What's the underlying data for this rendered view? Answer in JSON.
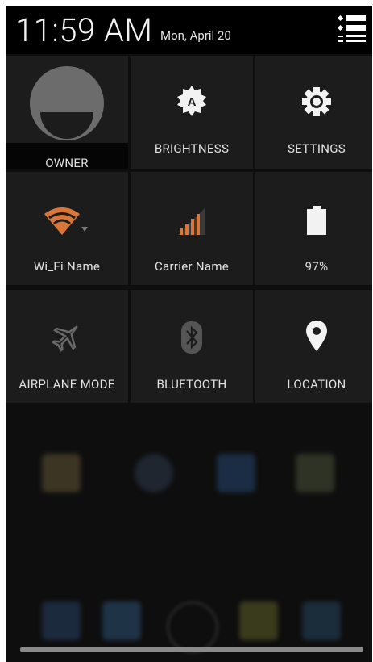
{
  "status": {
    "time": "11:59 AM",
    "date": "Mon, April 20",
    "menu_icon": "settings-list-icon"
  },
  "tiles": {
    "owner": {
      "label": "OWNER",
      "icon": "avatar-icon"
    },
    "brightness": {
      "label": "BRIGHTNESS",
      "icon": "brightness-auto-icon"
    },
    "settings": {
      "label": "SETTINGS",
      "icon": "gear-icon"
    },
    "wifi": {
      "label": "Wi_Fi Name",
      "icon": "wifi-icon",
      "color": "#d9773a"
    },
    "carrier": {
      "label": "Carrier Name",
      "icon": "signal-icon",
      "color": "#d9773a"
    },
    "battery": {
      "label": "97%",
      "icon": "battery-icon"
    },
    "airplane": {
      "label": "AIRPLANE MODE",
      "icon": "airplane-icon"
    },
    "bluetooth": {
      "label": "BLUETOOTH",
      "icon": "bluetooth-icon"
    },
    "location": {
      "label": "LOCATION",
      "icon": "location-pin-icon"
    }
  },
  "colors": {
    "header_bg": "#000000",
    "tile_bg": "#1c1c1c",
    "accent": "#d9773a"
  }
}
